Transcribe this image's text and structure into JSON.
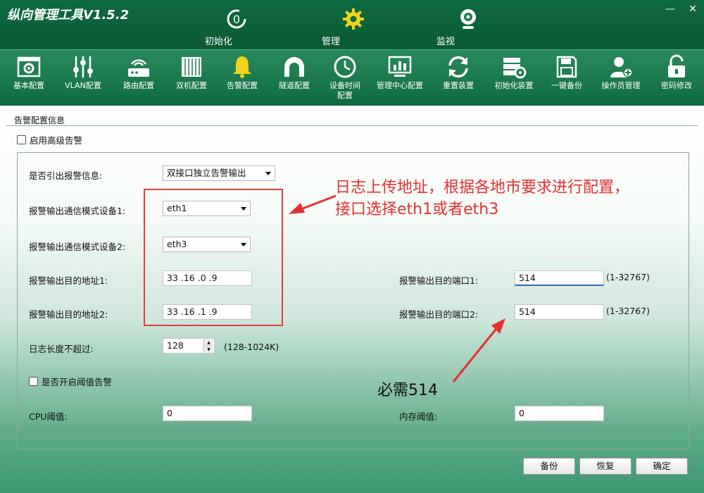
{
  "app": {
    "title": "纵向管理工具V1.5.2"
  },
  "window_controls": {
    "minimize": "—",
    "close": "✕"
  },
  "main_nav": [
    {
      "label": "初始化",
      "icon": "init-icon"
    },
    {
      "label": "管理",
      "icon": "gear-icon"
    },
    {
      "label": "监视",
      "icon": "webcam-icon"
    }
  ],
  "toolbar": [
    {
      "label": "基本配置",
      "icon": "settings-panel-icon"
    },
    {
      "label": "VLAN配置",
      "icon": "sliders-icon"
    },
    {
      "label": "路由配置",
      "icon": "router-icon"
    },
    {
      "label": "双机配置",
      "icon": "server-rack-icon"
    },
    {
      "label": "告警配置",
      "icon": "bell-icon"
    },
    {
      "label": "隧道配置",
      "icon": "tunnel-icon"
    },
    {
      "label": "设备时间\n配置",
      "icon": "clock-icon"
    },
    {
      "label": "管理中心配置",
      "icon": "monitor-chart-icon"
    },
    {
      "label": "重置装置",
      "icon": "refresh-icon"
    },
    {
      "label": "初始化装置",
      "icon": "server-gear-icon"
    },
    {
      "label": "一键备份",
      "icon": "floppy-icon"
    },
    {
      "label": "操作员管理",
      "icon": "user-add-icon"
    },
    {
      "label": "密码修改",
      "icon": "lock-icon"
    }
  ],
  "form": {
    "section_title": "告警配置信息",
    "advanced_alarm": "启用高级告警",
    "lead_out_label": "是否引出报警信息:",
    "lead_out_value": "双接口独立告警输出",
    "device1_label": "报警输出通信模式设备1:",
    "device1_value": "eth1",
    "device2_label": "报警输出通信模式设备2:",
    "device2_value": "eth3",
    "addr1_label": "报警输出目的地址1:",
    "addr1_value": "33 .16 .0  .9",
    "addr2_label": "报警输出目的地址2:",
    "addr2_value": "33 .16 .1  .9",
    "port1_label": "报警输出目的端口1:",
    "port1_value": "514",
    "port1_range": "(1-32767)",
    "port2_label": "报警输出目的端口2:",
    "port2_value": "514",
    "port2_range": "(1-32767)",
    "log_len_label": "日志长度不超过:",
    "log_len_value": "128",
    "log_len_range": "(128-1024K)",
    "threshold_alarm": "是否开启阈值告警",
    "cpu_label": "CPU阈值:",
    "cpu_value": "0",
    "mem_label": "内存阈值:",
    "mem_value": "0"
  },
  "annotations": {
    "note_line1": "日志上传地址，根据各地市要求进行配置，",
    "note_line2": "接口选择eth1或者eth3",
    "required_note": "必需514",
    "color": "#e53030"
  },
  "buttons": {
    "backup": "备份",
    "restore": "恢复",
    "confirm": "确定"
  }
}
